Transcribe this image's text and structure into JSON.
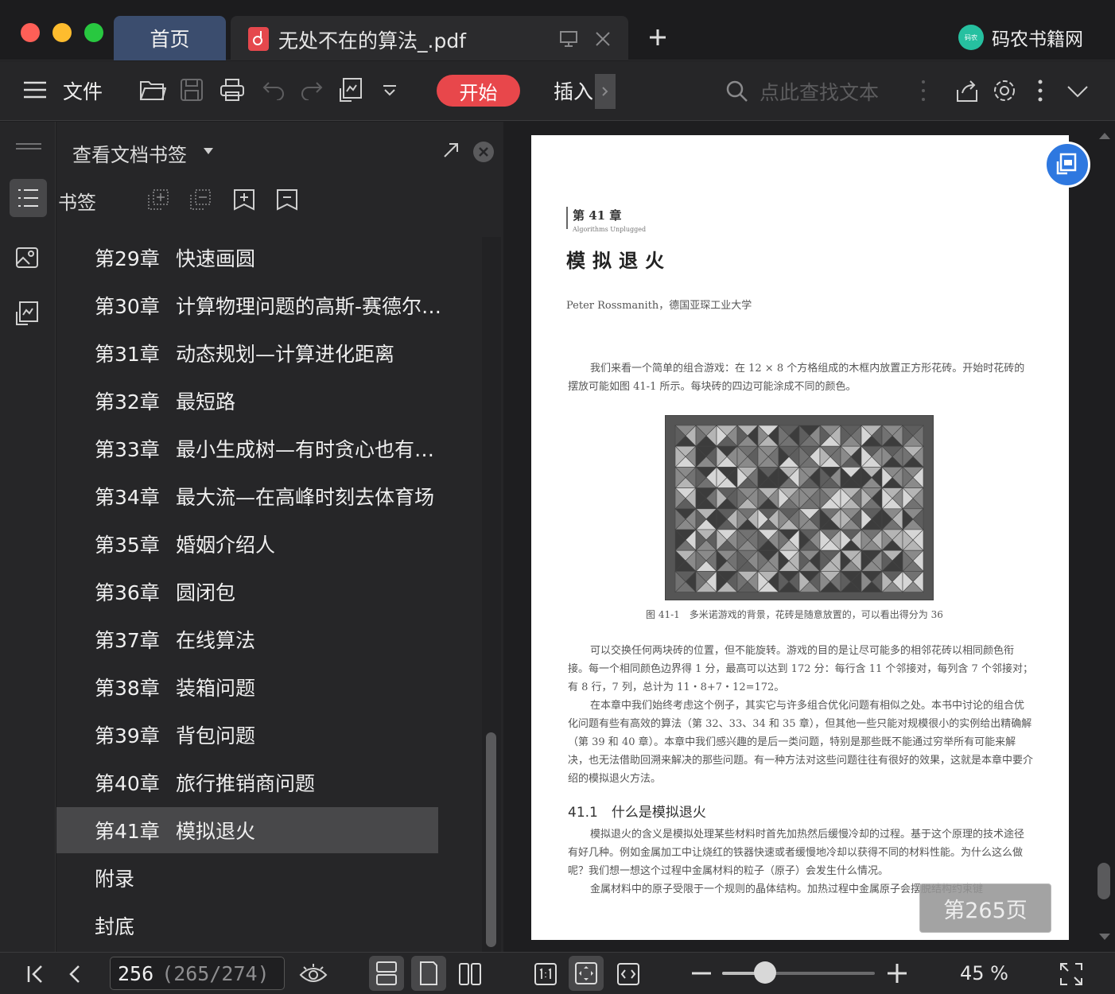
{
  "window": {
    "tabs": [
      {
        "label": "首页"
      },
      {
        "label": "无处不在的算法_.pdf"
      }
    ],
    "brand": {
      "name": "码农书籍网",
      "logo_text": "码农"
    }
  },
  "toolbar": {
    "file_label": "文件",
    "start_label": "开始",
    "insert_label": "插入",
    "search_placeholder": "点此查找文本",
    "accent": "#e8474b"
  },
  "panel": {
    "title": "查看文档书签",
    "section_label": "书签",
    "bookmarks": [
      {
        "chapter": "第29章",
        "name": "快速画圆"
      },
      {
        "chapter": "第30章",
        "name": "计算物理问题的高斯-赛德尔…"
      },
      {
        "chapter": "第31章",
        "name": "动态规划—计算进化距离"
      },
      {
        "chapter": "第32章",
        "name": "最短路"
      },
      {
        "chapter": "第33章",
        "name": "最小生成树—有时贪心也有…"
      },
      {
        "chapter": "第34章",
        "name": "最大流—在高峰时刻去体育场"
      },
      {
        "chapter": "第35章",
        "name": "婚姻介绍人"
      },
      {
        "chapter": "第36章",
        "name": "圆闭包"
      },
      {
        "chapter": "第37章",
        "name": "在线算法"
      },
      {
        "chapter": "第38章",
        "name": "装箱问题"
      },
      {
        "chapter": "第39章",
        "name": "背包问题"
      },
      {
        "chapter": "第40章",
        "name": "旅行推销商问题"
      },
      {
        "chapter": "第41章",
        "name": "模拟退火"
      },
      {
        "chapter": "",
        "name": "附录"
      },
      {
        "chapter": "",
        "name": "封底"
      }
    ],
    "selected_index": 12
  },
  "document": {
    "chapter_label": "第 41 章",
    "chapter_sub": "Algorithms Unplugged",
    "title": "模拟退火",
    "author": "Peter Rossmanith，德国亚琛工业大学",
    "para1": "我们来看一个简单的组合游戏：在 12 × 8 个方格组成的木框内放置正方形花砖。开始时花砖的摆放可能如图 41-1 所示。每块砖的四边可能涂成不同的颜色。",
    "figure_caption": "图 41-1　多米诺游戏的背景，花砖是随意放置的，可以看出得分为 36",
    "para2": "可以交换任何两块砖的位置，但不能旋转。游戏的目的是让尽可能多的相邻花砖以相同颜色衔接。每一个相同颜色边界得 1 分，最高可以达到 172 分：每行含 11 个邻接对，每列含 7 个邻接对；有 8 行，7 列，总计为 11・8+7・12=172。",
    "para3": "在本章中我们始终考虑这个例子，其实它与许多组合优化问题有相似之处。本书中讨论的组合优化问题有些有高效的算法（第 32、33、34 和 35 章），但其他一些只能对规模很小的实例给出精确解（第 39 和 40 章）。本章中我们感兴趣的是后一类问题，特别是那些既不能通过穷举所有可能来解决，也无法借助回溯来解决的那些问题。有一种方法对这些问题往往有很好的效果，这就是本章中要介绍的模拟退火方法。",
    "section_heading": "41.1　什么是模拟退火",
    "para4": "模拟退火的含义是模拟处理某些材料时首先加热然后缓慢冷却的过程。基于这个原理的技术途径有好几种。例如金属加工中让烧红的铁器快速或者缓慢地冷却以获得不同的材料性能。为什么这么做呢？我们想一想这个过程中金属材料的粒子（原子）会发生什么情况。",
    "para5": "金属材料中的原子受限于一个规则的晶体结构。加热过程中金属原子会摆脱结构约束键",
    "page_badge": "第265页"
  },
  "statusbar": {
    "page_current": "256",
    "page_total": "(265/274)",
    "zoom": "45 %",
    "zoom_fraction": 0.28
  }
}
